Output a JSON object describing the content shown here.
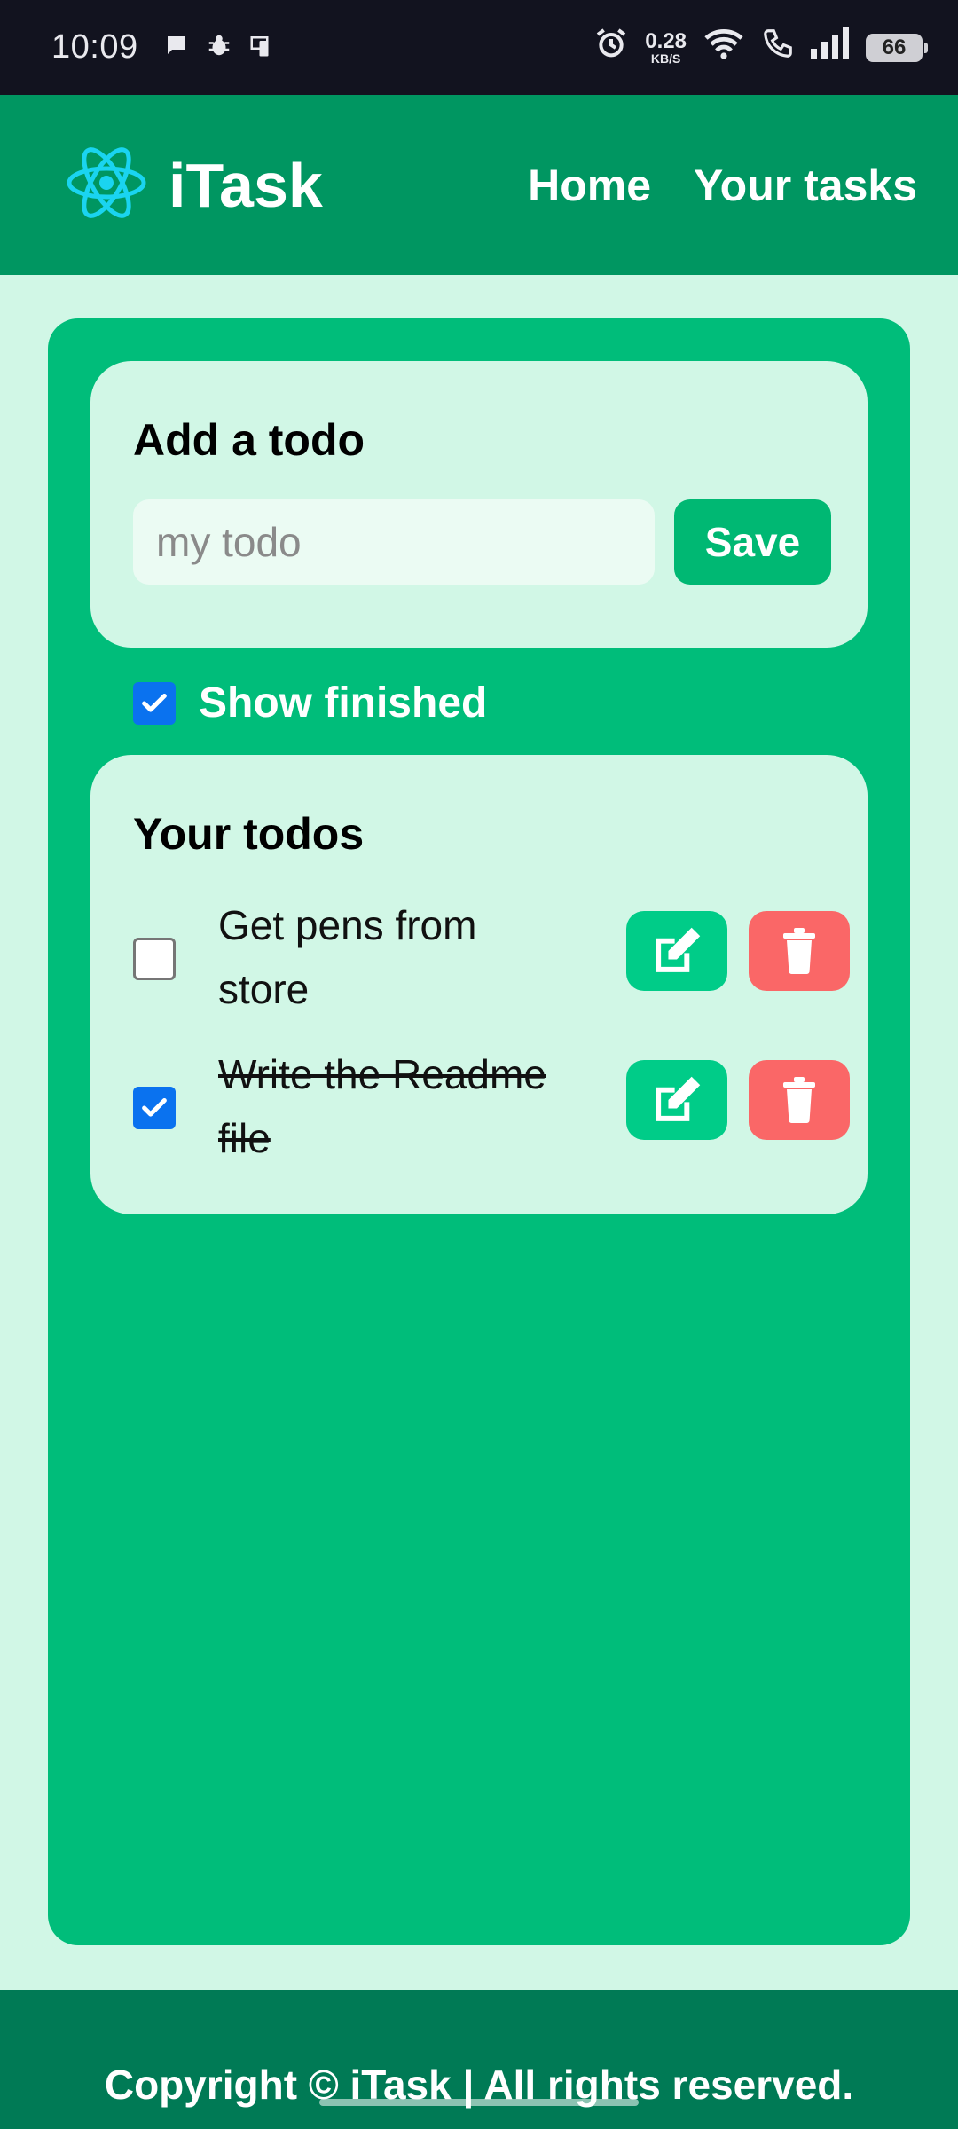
{
  "status_bar": {
    "time": "10:09",
    "net_speed": "0.28",
    "net_unit": "KB/S",
    "battery": "66",
    "icons": [
      "chat-icon",
      "bug-icon",
      "phone-icon",
      "alarm-icon",
      "wifi-icon",
      "call-icon",
      "signal-icon",
      "battery-icon"
    ]
  },
  "navbar": {
    "brand": "iTask",
    "logo_icon": "atom-icon",
    "links": [
      "Home",
      "Your tasks"
    ]
  },
  "add_todo": {
    "title": "Add a todo",
    "input_placeholder": "my todo",
    "input_value": "",
    "save_label": "Save"
  },
  "show_finished": {
    "label": "Show finished",
    "checked": true
  },
  "todos": {
    "title": "Your todos",
    "items": [
      {
        "text": "Get pens from store",
        "done": false
      },
      {
        "text": "Write the Readme file",
        "done": true
      }
    ],
    "edit_icon": "edit-icon",
    "delete_icon": "trash-icon"
  },
  "footer": {
    "text": "Copyright © iTask | All rights reserved."
  },
  "colors": {
    "page_bg": "#d1f7e6",
    "navbar": "#009661",
    "main": "#00bd7a",
    "edit": "#00cc88",
    "delete": "#fa6767",
    "footer": "#007a55",
    "checkbox": "#0a72ef"
  }
}
